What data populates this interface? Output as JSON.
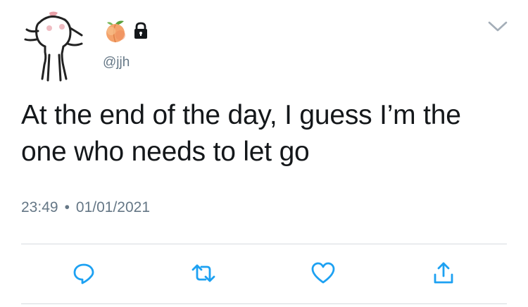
{
  "tweet": {
    "name_emoji": "peach-emoji",
    "locked": true,
    "handle": "@jjh",
    "text": "At the end of the day, I guess I’m the one who needs to let go",
    "time": "23:49",
    "separator": "•",
    "date": "01/01/2021"
  },
  "actions": [
    {
      "icon": "reply-icon"
    },
    {
      "icon": "retweet-icon"
    },
    {
      "icon": "like-icon"
    },
    {
      "icon": "share-icon"
    }
  ],
  "colors": {
    "text": "#14171a",
    "secondary": "#657786",
    "icon": "#1da1f2",
    "peach": "#f4a26b",
    "divider": "#d6dbdf"
  }
}
